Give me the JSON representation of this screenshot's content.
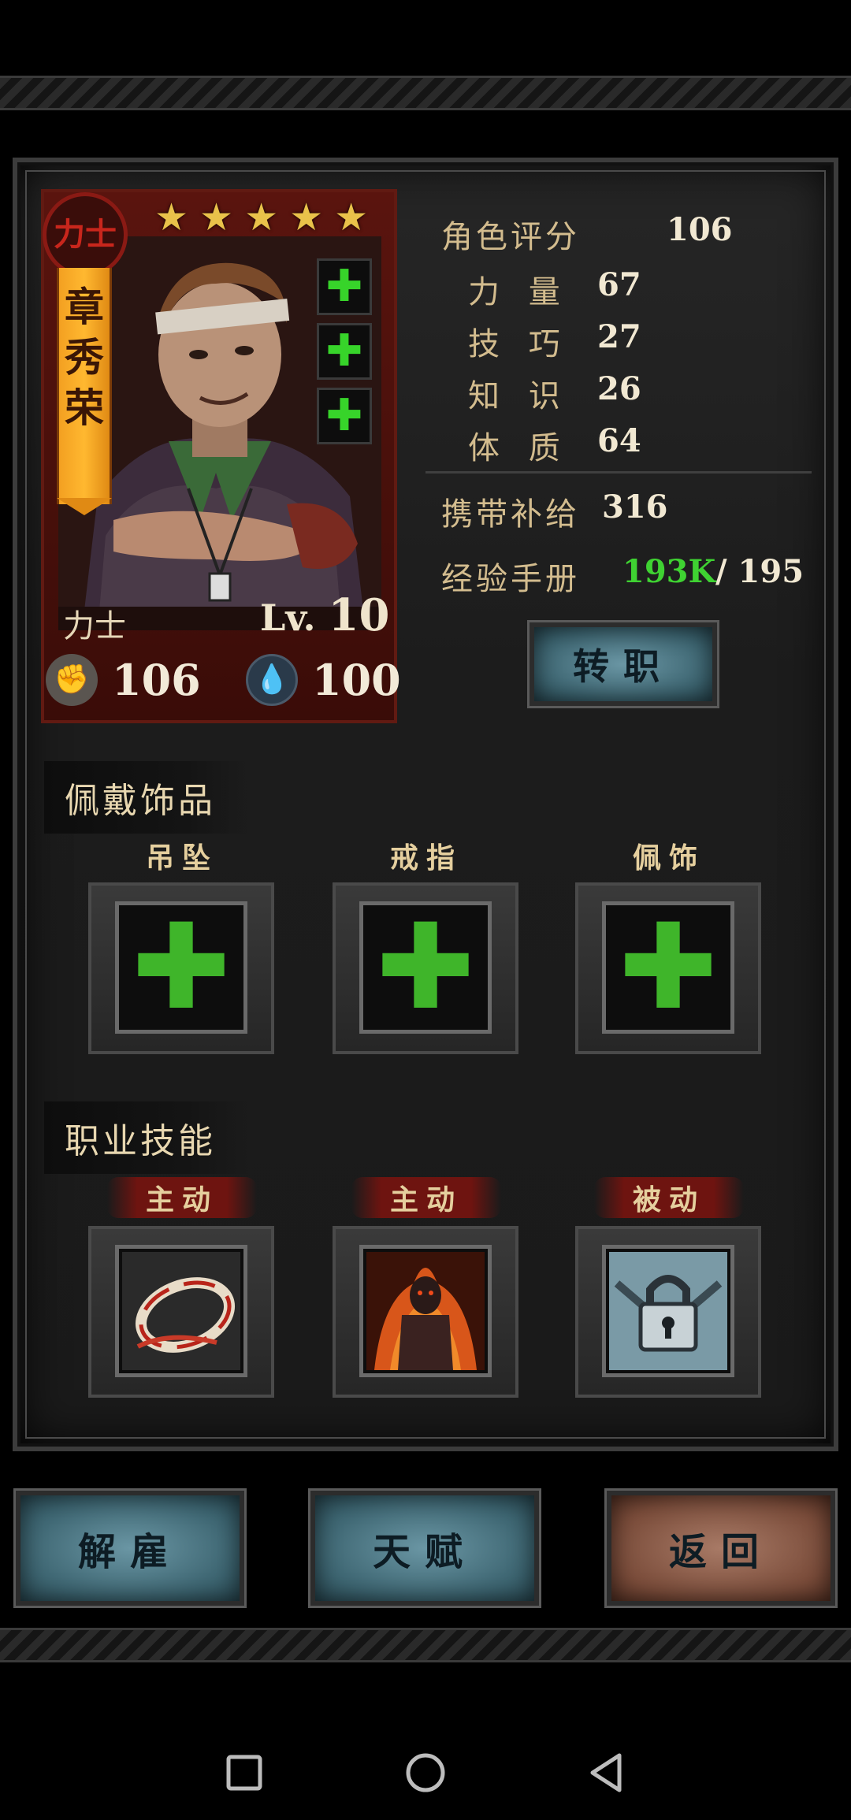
{
  "hero": {
    "class_seal": "力士",
    "stars": 5,
    "name_chars": [
      "章",
      "秀",
      "荣"
    ],
    "class_name": "力士",
    "level_prefix": "Lv.",
    "level": "10",
    "strength_power": "106",
    "spirit": "100"
  },
  "stats": {
    "rating_label": "角色评分",
    "rating_value": "106",
    "items": [
      {
        "label": "力 量",
        "value": "67"
      },
      {
        "label": "技 巧",
        "value": "27"
      },
      {
        "label": "知 识",
        "value": "26"
      },
      {
        "label": "体 质",
        "value": "64"
      }
    ],
    "supplies_label": "携带补给",
    "supplies_value": "316",
    "exp_label": "经验手册",
    "exp_current": "193K",
    "exp_max": "/ 195"
  },
  "buttons": {
    "job_change": "转职",
    "dismiss": "解雇",
    "talent": "天赋",
    "back": "返回"
  },
  "accessories": {
    "title": "佩戴饰品",
    "slots": [
      {
        "label": "吊坠"
      },
      {
        "label": "戒指"
      },
      {
        "label": "佩饰"
      }
    ]
  },
  "skills": {
    "title": "职业技能",
    "slots": [
      {
        "label": "主动",
        "icon": "whirlwind-slash-icon"
      },
      {
        "label": "主动",
        "icon": "burning-rage-icon"
      },
      {
        "label": "被动",
        "icon": "locked-chain-icon"
      }
    ]
  },
  "colors": {
    "accent_green": "#3fd232",
    "gold": "#e9c24a",
    "banner_orange": "#ffb830"
  }
}
